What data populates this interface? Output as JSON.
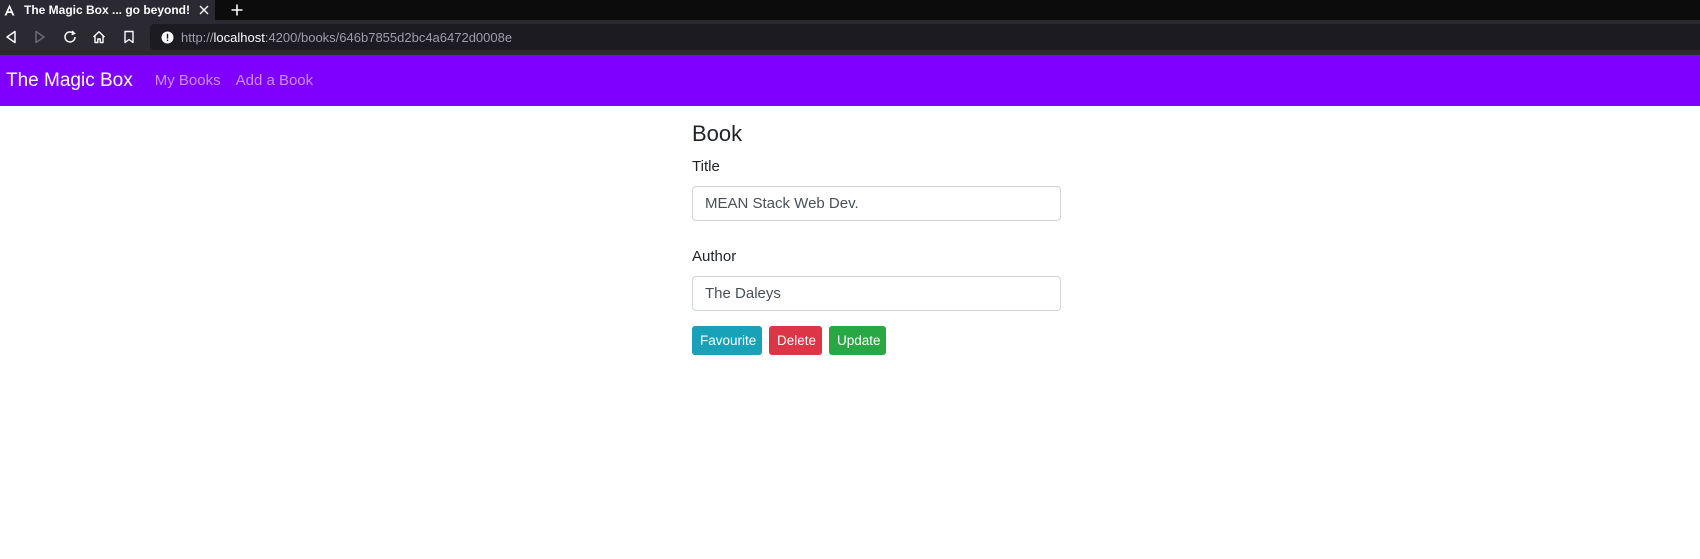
{
  "browser": {
    "tab_title": "The Magic Box ... go beyond!",
    "url_prefix": "http://",
    "url_host": "localhost",
    "url_path": ":4200/books/646b7855d2bc4a6472d0008e"
  },
  "navbar": {
    "brand": "The Magic Box",
    "links": [
      "My Books",
      "Add a Book"
    ],
    "color": "#8000ff"
  },
  "form": {
    "heading": "Book",
    "title_label": "Title",
    "title_value": "MEAN Stack Web Dev.",
    "author_label": "Author",
    "author_value": "The Daleys"
  },
  "buttons": {
    "favourite": "Favourite",
    "delete": "Delete",
    "update": "Update"
  },
  "colors": {
    "info": "#17a2b8",
    "danger": "#dc3545",
    "success": "#28a745"
  }
}
